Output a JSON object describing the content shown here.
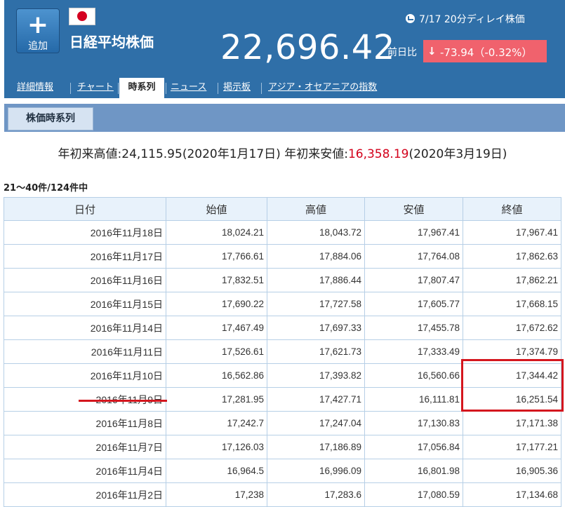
{
  "header": {
    "add_button_label": "追加",
    "index_name": "日経平均株価",
    "delay_note": "7/17 20分ディレイ株価",
    "price": "22,696.42",
    "change_label": "前日比",
    "change_value": "-73.94（-0.32%）",
    "accent_color": "#2f6fa8",
    "down_color": "#f0626d"
  },
  "tabs": [
    {
      "label": "詳細情報",
      "active": false
    },
    {
      "label": "チャート",
      "active": false
    },
    {
      "label": "時系列",
      "active": true
    },
    {
      "label": "ニュース",
      "active": false
    },
    {
      "label": "掲示板",
      "active": false
    },
    {
      "label": "アジア・オセアニアの指数",
      "active": false
    }
  ],
  "subtab_label": "株価時系列",
  "range": {
    "high_label": "年初来高値:",
    "high_value": "24,115.95",
    "high_date": "(2020年1月17日)",
    "low_label": "年初来安値:",
    "low_value": "16,358.19",
    "low_date": "(2020年3月19日)"
  },
  "result_count": "21〜40件/124件中",
  "table": {
    "headers": [
      "日付",
      "始値",
      "高値",
      "安値",
      "終値"
    ],
    "rows": [
      [
        "2016年11月18日",
        "18,024.21",
        "18,043.72",
        "17,967.41",
        "17,967.41"
      ],
      [
        "2016年11月17日",
        "17,766.61",
        "17,884.06",
        "17,764.08",
        "17,862.63"
      ],
      [
        "2016年11月16日",
        "17,832.51",
        "17,886.44",
        "17,807.47",
        "17,862.21"
      ],
      [
        "2016年11月15日",
        "17,690.22",
        "17,727.58",
        "17,605.77",
        "17,668.15"
      ],
      [
        "2016年11月14日",
        "17,467.49",
        "17,697.33",
        "17,455.78",
        "17,672.62"
      ],
      [
        "2016年11月11日",
        "17,526.61",
        "17,621.73",
        "17,333.49",
        "17,374.79"
      ],
      [
        "2016年11月10日",
        "16,562.86",
        "17,393.82",
        "16,560.66",
        "17,344.42"
      ],
      [
        "2016年11月9日",
        "17,281.95",
        "17,427.71",
        "16,111.81",
        "16,251.54"
      ],
      [
        "2016年11月8日",
        "17,242.7",
        "17,247.04",
        "17,130.83",
        "17,171.38"
      ],
      [
        "2016年11月7日",
        "17,126.03",
        "17,186.89",
        "17,056.84",
        "17,177.21"
      ],
      [
        "2016年11月4日",
        "16,964.5",
        "16,996.09",
        "16,801.98",
        "16,905.36"
      ],
      [
        "2016年11月2日",
        "17,238",
        "17,283.6",
        "17,080.59",
        "17,134.68"
      ]
    ]
  },
  "annotation_color": "#d4161e"
}
